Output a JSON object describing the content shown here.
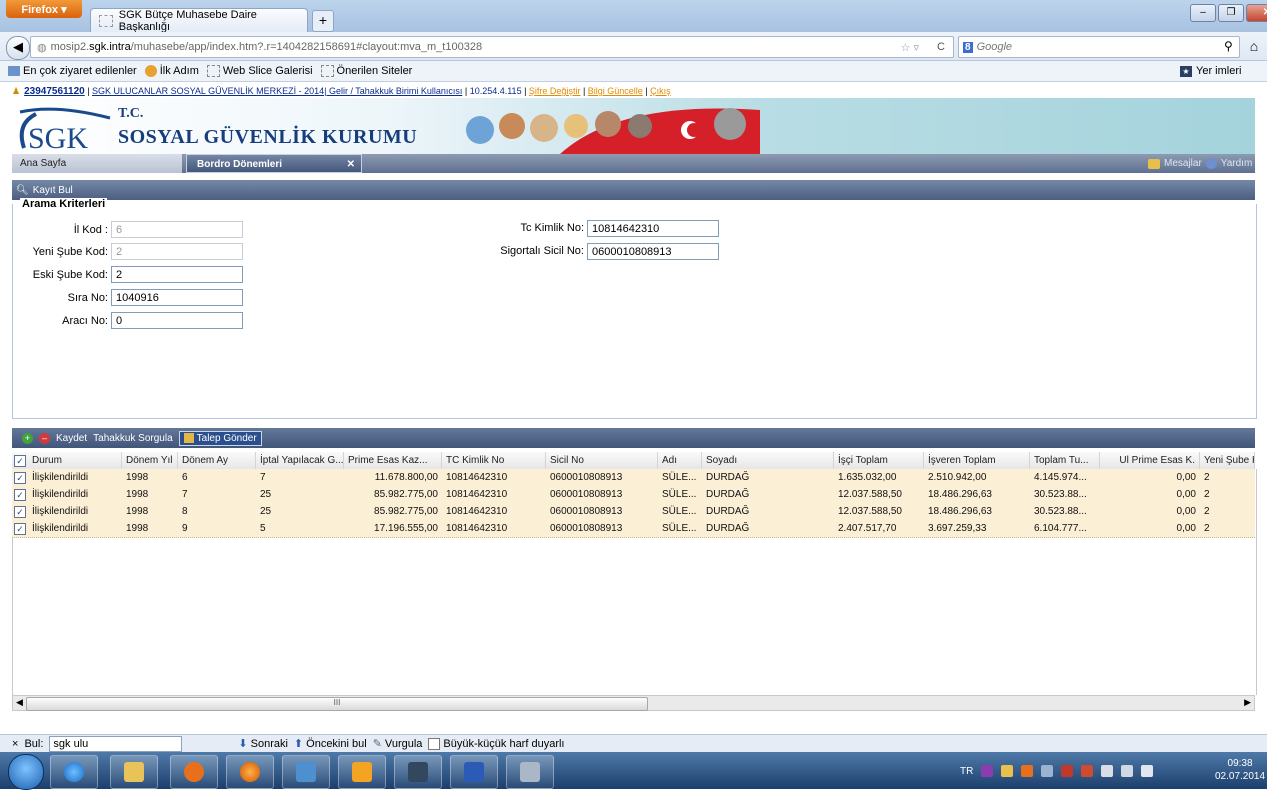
{
  "browser": {
    "menu_button": "Firefox ▾",
    "tab_title": "SGK Bütçe Muhasebe Daire Başkanlığı",
    "new_tab": "+",
    "url_prefix": "mosip2.",
    "url_host": "sgk.intra",
    "url_rest": "/muhasebe/app/index.htm?.r=1404282158691#clayout:mva_m_t100328",
    "search_engine": "Google",
    "bookmarks": [
      "En çok ziyaret edilenler",
      "İlk Adım",
      "Web Slice Galerisi",
      "Önerilen Siteler"
    ],
    "bookmarks_menu": "Yer imleri"
  },
  "page": {
    "user_id": "23947561120",
    "user_info": "SGK ULUCANLAR SOSYAL GÜVENLİK MERKEZİ - 2014| Gelir / Tahakkuk Birimi Kullanıcısı",
    "ip": "10.254.4.115",
    "link_sifre": "Şifre Değiştir",
    "link_bilgi": "Bilgi Güncelle",
    "link_cikis": "Çıkış",
    "logo_text": "SGK",
    "tc": "T.C.",
    "kurum": "SOSYAL GÜVENLİK KURUMU",
    "tabs": {
      "ana": "Ana Sayfa",
      "bordro": "Bordro Dönemleri"
    },
    "mesajlar": "Mesajlar",
    "yardim": "Yardım",
    "kayit_bul": "Kayıt Bul",
    "legend": "Arama Kriterleri"
  },
  "form": {
    "il_kod": {
      "label": "İl Kod :",
      "value": "6"
    },
    "yeni_sube": {
      "label": "Yeni Şube Kod:",
      "value": "2"
    },
    "eski_sube": {
      "label": "Eski Şube Kod:",
      "value": "2"
    },
    "sira_no": {
      "label": "Sıra No:",
      "value": "1040916"
    },
    "araci_no": {
      "label": "Aracı No:",
      "value": "0"
    },
    "tc_kimlik": {
      "label": "Tc Kimlik No:",
      "value": "10814642310"
    },
    "sicil_no": {
      "label": "Sigortalı Sicil No:",
      "value": "0600010808913"
    }
  },
  "grid": {
    "toolbar": {
      "kaydet": "Kaydet",
      "tahakkuk": "Tahakkuk Sorgula",
      "talep": "Talep Gönder"
    },
    "columns": [
      "Durum",
      "Dönem Yıl",
      "Dönem Ay",
      "İptal Yapılacak G...",
      "Prime Esas Kaz...",
      "TC Kimlik No",
      "Sicil No",
      "Adı",
      "Soyadı",
      "İşçi Toplam",
      "İşveren Toplam",
      "Toplam Tu...",
      "Ul Prime Esas K.",
      "Yeni Şube K."
    ],
    "rows": [
      [
        "İlişkilendirildi",
        "1998",
        "6",
        "7",
        "11.678.800,00",
        "10814642310",
        "0600010808913",
        "SÜLE...",
        "DURDAĞ",
        "1.635.032,00",
        "2.510.942,00",
        "4.145.974...",
        "0,00",
        "2"
      ],
      [
        "İlişkilendirildi",
        "1998",
        "7",
        "25",
        "85.982.775,00",
        "10814642310",
        "0600010808913",
        "SÜLE...",
        "DURDAĞ",
        "12.037.588,50",
        "18.486.296,63",
        "30.523.88...",
        "0,00",
        "2"
      ],
      [
        "İlişkilendirildi",
        "1998",
        "8",
        "25",
        "85.982.775,00",
        "10814642310",
        "0600010808913",
        "SÜLE...",
        "DURDAĞ",
        "12.037.588,50",
        "18.486.296,63",
        "30.523.88...",
        "0,00",
        "2"
      ],
      [
        "İlişkilendirildi",
        "1998",
        "9",
        "5",
        "17.196.555,00",
        "10814642310",
        "0600010808913",
        "SÜLE...",
        "DURDAĞ",
        "2.407.517,70",
        "3.697.259,33",
        "6.104.777...",
        "0,00",
        "2"
      ]
    ],
    "scroll_thumb": "III"
  },
  "findbar": {
    "close": "×",
    "label": "Bul:",
    "value": "sgk ulu",
    "next": "Sonraki",
    "prev": "Öncekini bul",
    "highlight": "Vurgula",
    "case": "Büyük-küçük harf duyarlı"
  },
  "taskbar": {
    "lang": "TR",
    "time": "09:38",
    "date": "02.07.2014"
  }
}
